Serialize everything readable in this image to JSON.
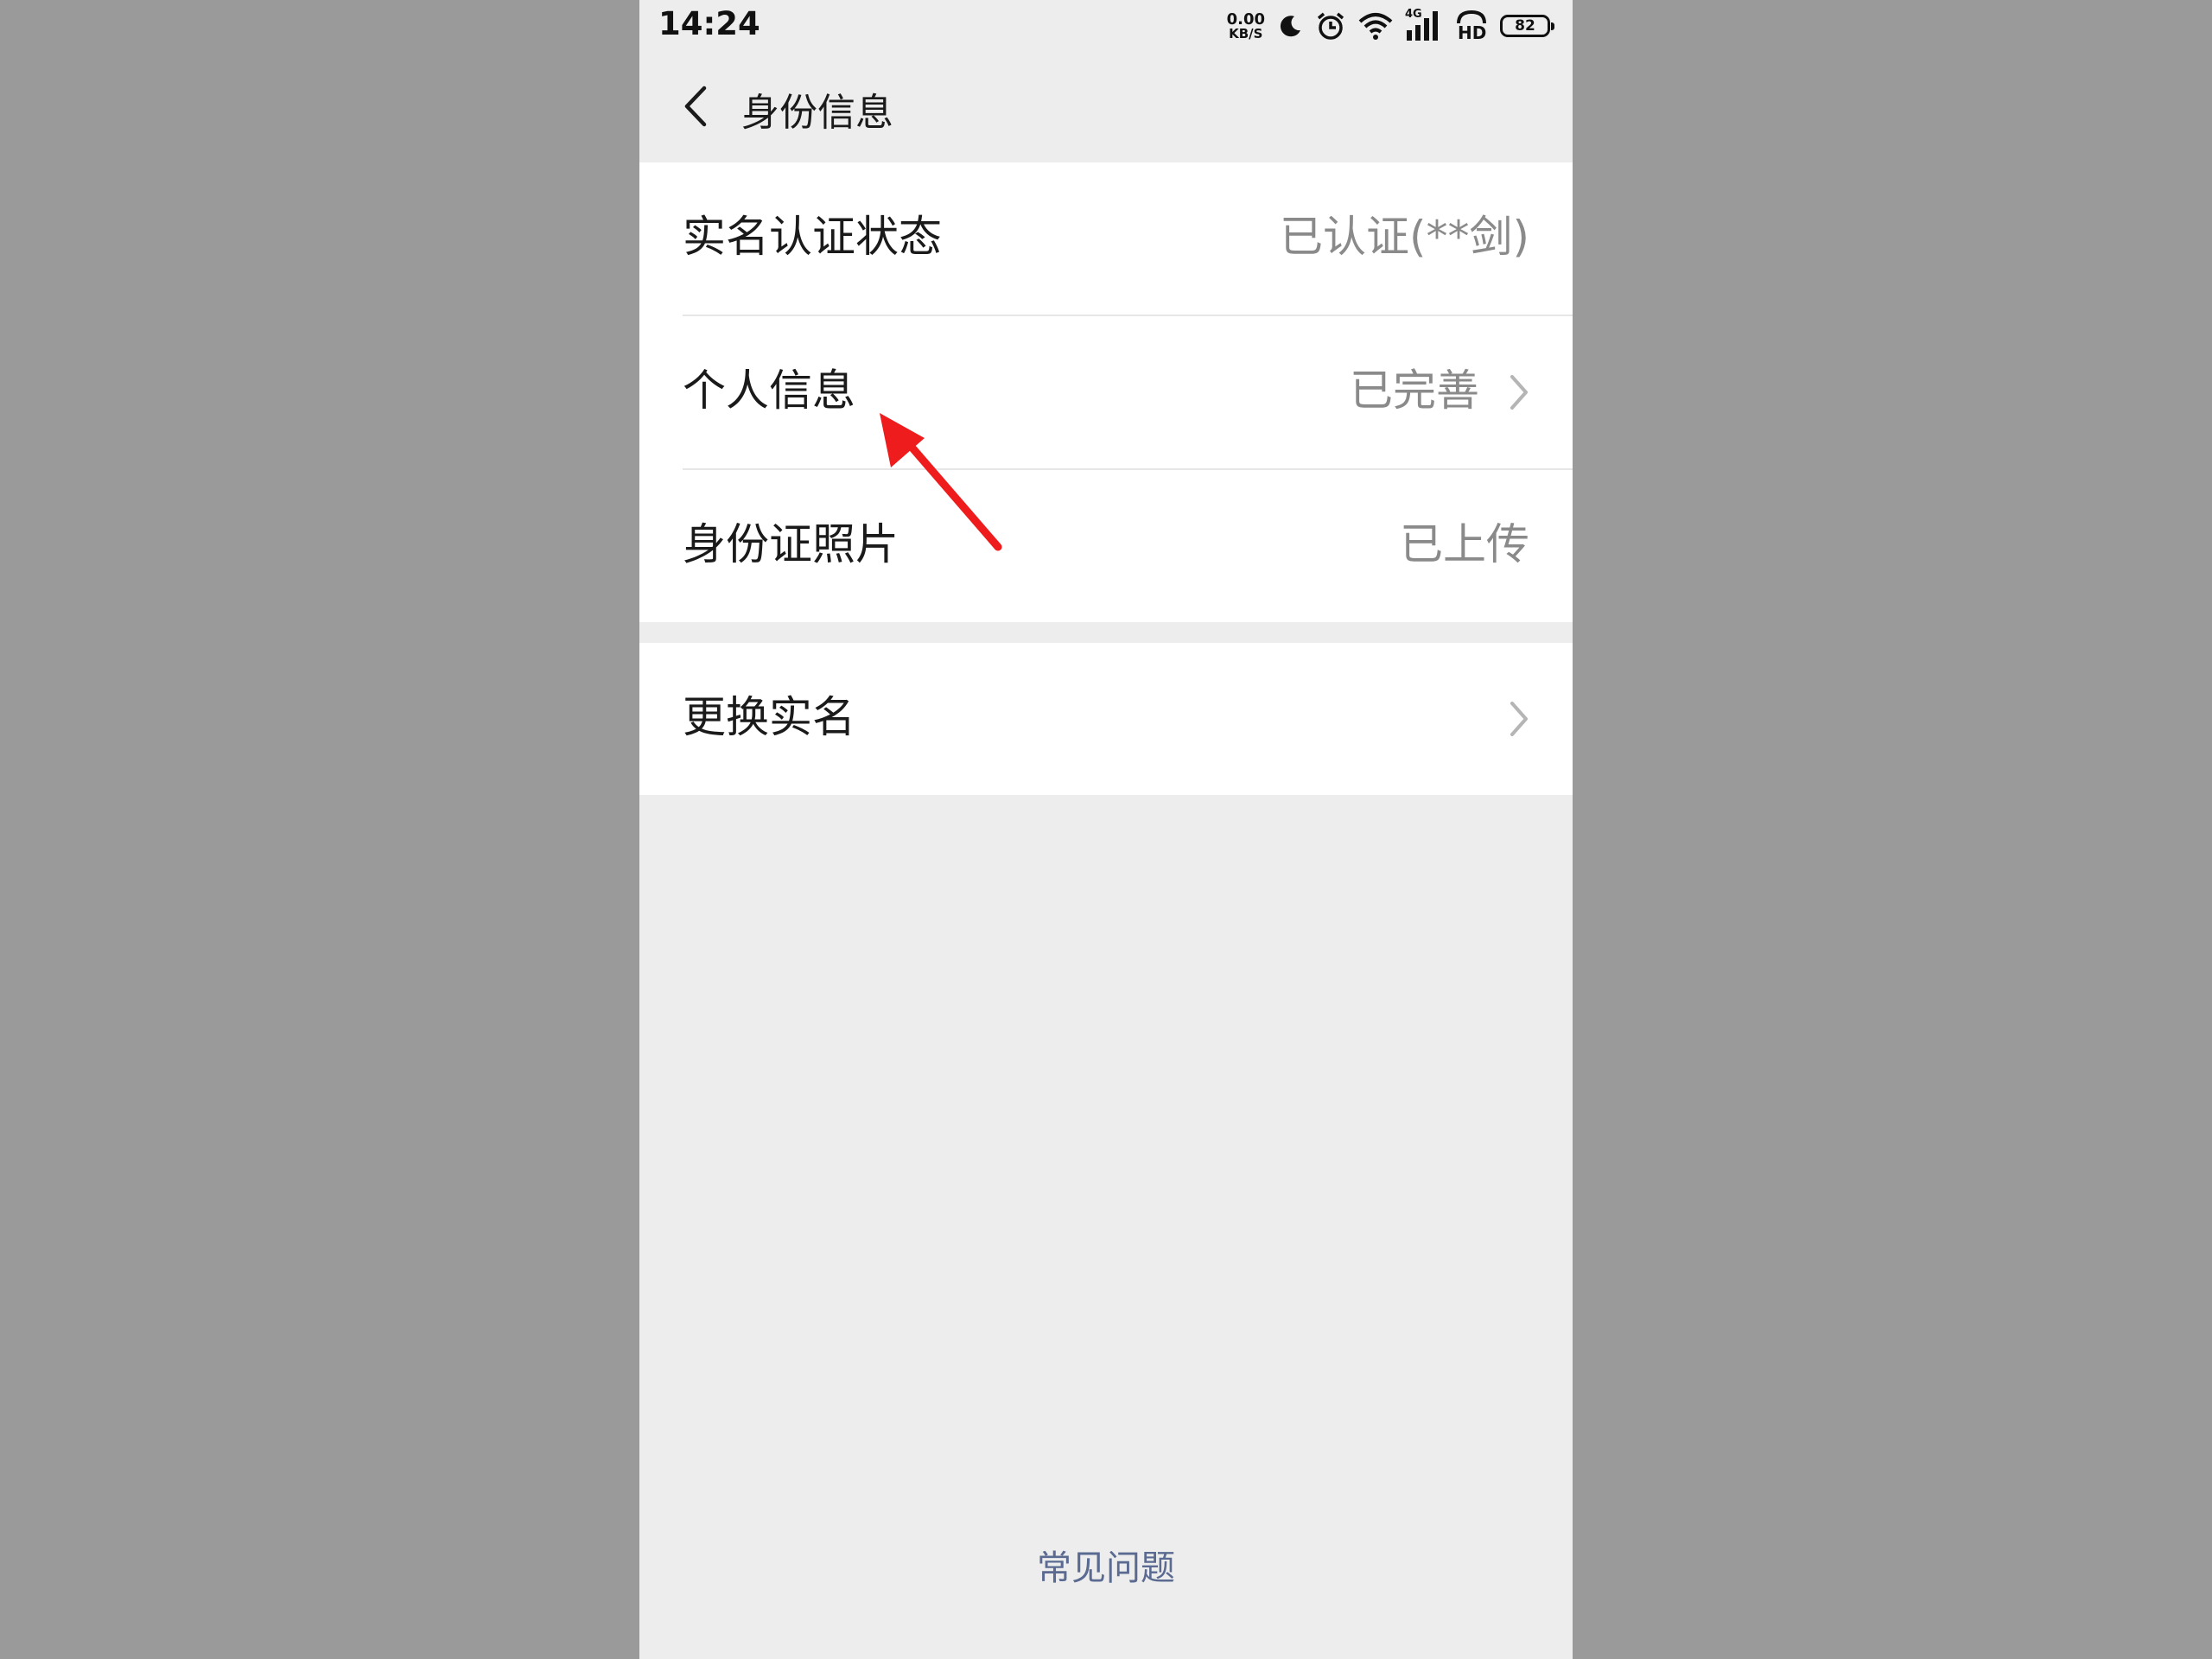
{
  "status_bar": {
    "time": "14:24",
    "net_speed_value": "0.00",
    "net_speed_unit": "KB/S",
    "network_type": "4G",
    "hd_label": "HD",
    "battery": "82"
  },
  "header": {
    "title": "身份信息"
  },
  "rows": [
    {
      "label": "实名认证状态",
      "value": "已认证(**剑)"
    },
    {
      "label": "个人信息",
      "value": "已完善"
    },
    {
      "label": "身份证照片",
      "value": "已上传"
    }
  ],
  "change_row": {
    "label": "更换实名"
  },
  "footer": {
    "faq": "常见问题"
  },
  "colors": {
    "annotation_arrow": "#ee1c1c",
    "link": "#5b6a91"
  },
  "icons": {
    "back": "back-arrow-icon",
    "chevron": "chevron-right-icon",
    "annotation": "red-arrow-annotation-icon"
  }
}
